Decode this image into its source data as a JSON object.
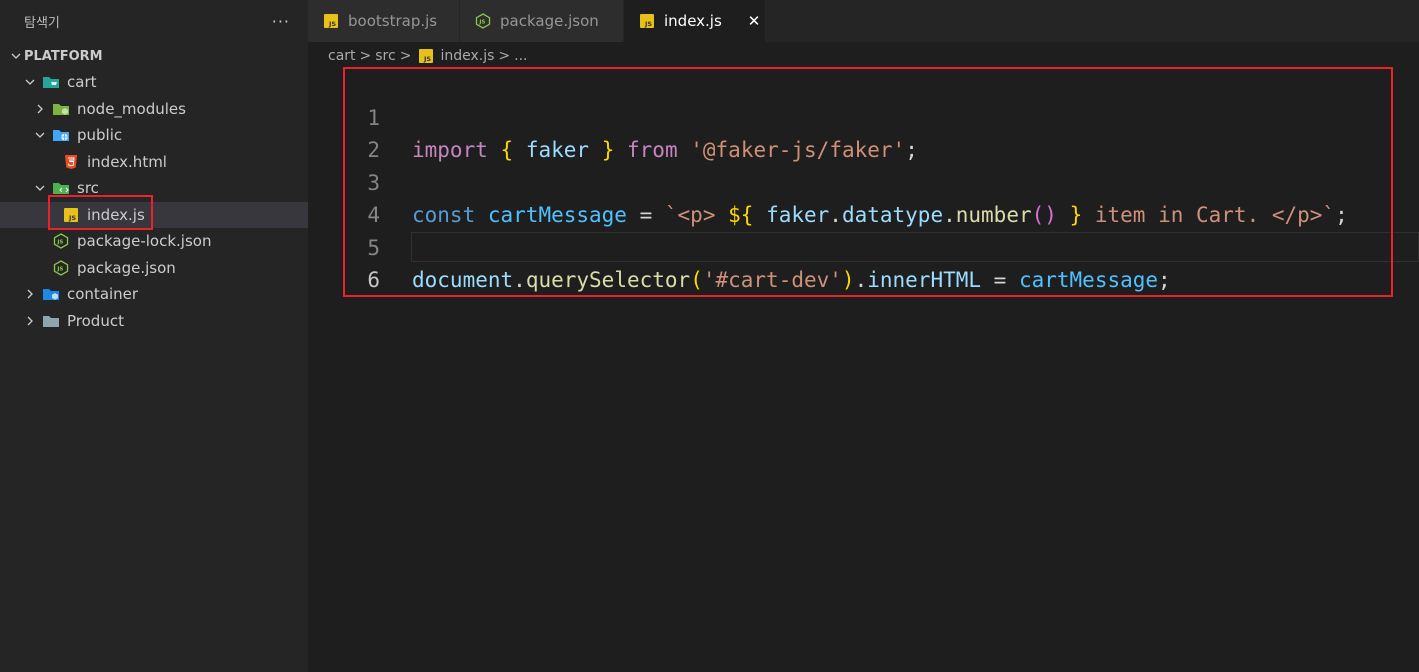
{
  "sidebar": {
    "title": "탐색기",
    "more": "···",
    "section": "PLATFORM",
    "tree": [
      {
        "label": "cart"
      },
      {
        "label": "node_modules"
      },
      {
        "label": "public"
      },
      {
        "label": "index.html"
      },
      {
        "label": "src"
      },
      {
        "label": "index.js"
      },
      {
        "label": "package-lock.json"
      },
      {
        "label": "package.json"
      },
      {
        "label": "container"
      },
      {
        "label": "Product"
      }
    ]
  },
  "tabs": [
    {
      "label": "bootstrap.js"
    },
    {
      "label": "package.json"
    },
    {
      "label": "index.js",
      "close": "✕"
    }
  ],
  "breadcrumb": {
    "p1": "cart",
    "p2": "src",
    "p3": "index.js",
    "p4": "...",
    "sep": ">"
  },
  "editor": {
    "line_numbers": [
      "1",
      "2",
      "3",
      "4",
      "5",
      "6"
    ],
    "line1": {
      "t1": "import",
      "t2": " ",
      "t3": "{",
      "t4": " ",
      "t5": "faker",
      "t6": " ",
      "t7": "}",
      "t8": " ",
      "t9": "from",
      "t10": " ",
      "t11": "'@faker-js/faker'",
      "t12": ";"
    },
    "line3": {
      "t1": "const",
      "t2": " ",
      "t3": "cartMessage",
      "t4": " = ",
      "t5": "`<p> ",
      "t6": "${",
      "t7": " ",
      "t8": "faker",
      "t9": ".",
      "t10": "datatype",
      "t11": ".",
      "t12": "number",
      "t13": "()",
      "t14": " ",
      "t15": "}",
      "t16": " item in Cart. </p>`",
      "t17": ";"
    },
    "line5": {
      "t1": "document",
      "t2": ".",
      "t3": "querySelector",
      "t4": "(",
      "t5": "'#cart-dev'",
      "t6": ")",
      "t7": ".",
      "t8": "innerHTML",
      "t9": " = ",
      "t10": "cartMessage",
      "t11": ";"
    }
  },
  "colors": {
    "highlight": "#e8232a",
    "js_icon": "#e8c01a",
    "node_icon": "#8cc84b",
    "folder_blue": "#42a5f5",
    "folder_green": "#7cb342",
    "html_icon": "#e44d26"
  }
}
